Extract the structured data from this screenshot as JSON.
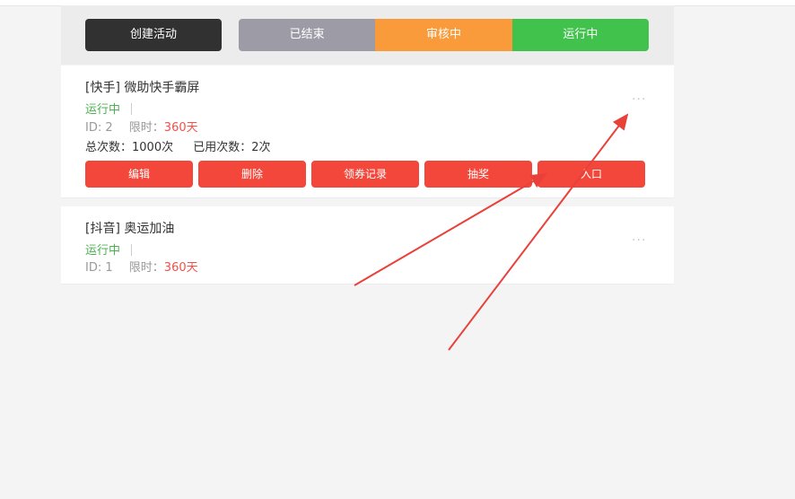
{
  "toolbar": {
    "create_label": "创建活动",
    "tabs": [
      {
        "label": "已结束"
      },
      {
        "label": "审核中"
      },
      {
        "label": "运行中"
      }
    ]
  },
  "activities": [
    {
      "title": "[快手] 微助快手霸屏",
      "status": "运行中",
      "id_text": "ID: 2",
      "limit_label": "限时：",
      "limit_value": "360天",
      "total_count": "总次数：1000次",
      "used_count": "已用次数：2次",
      "more": "···",
      "actions": [
        {
          "label": "编辑"
        },
        {
          "label": "删除"
        },
        {
          "label": "领券记录"
        },
        {
          "label": "抽奖"
        },
        {
          "label": "入口"
        }
      ]
    },
    {
      "title": "[抖音] 奥运加油",
      "status": "运行中",
      "id_text": "ID: 1",
      "limit_label": "限时：",
      "limit_value": "360天",
      "more": "···"
    }
  ],
  "colors": {
    "create_button": "#313131",
    "tab_ended": "#9d9ca6",
    "tab_review": "#f99b3a",
    "tab_running": "#41c24c",
    "action_button": "#f2473a",
    "status_running": "#4cb050",
    "limit_value": "#f0524a",
    "annotation_arrow": "#e8413a"
  }
}
